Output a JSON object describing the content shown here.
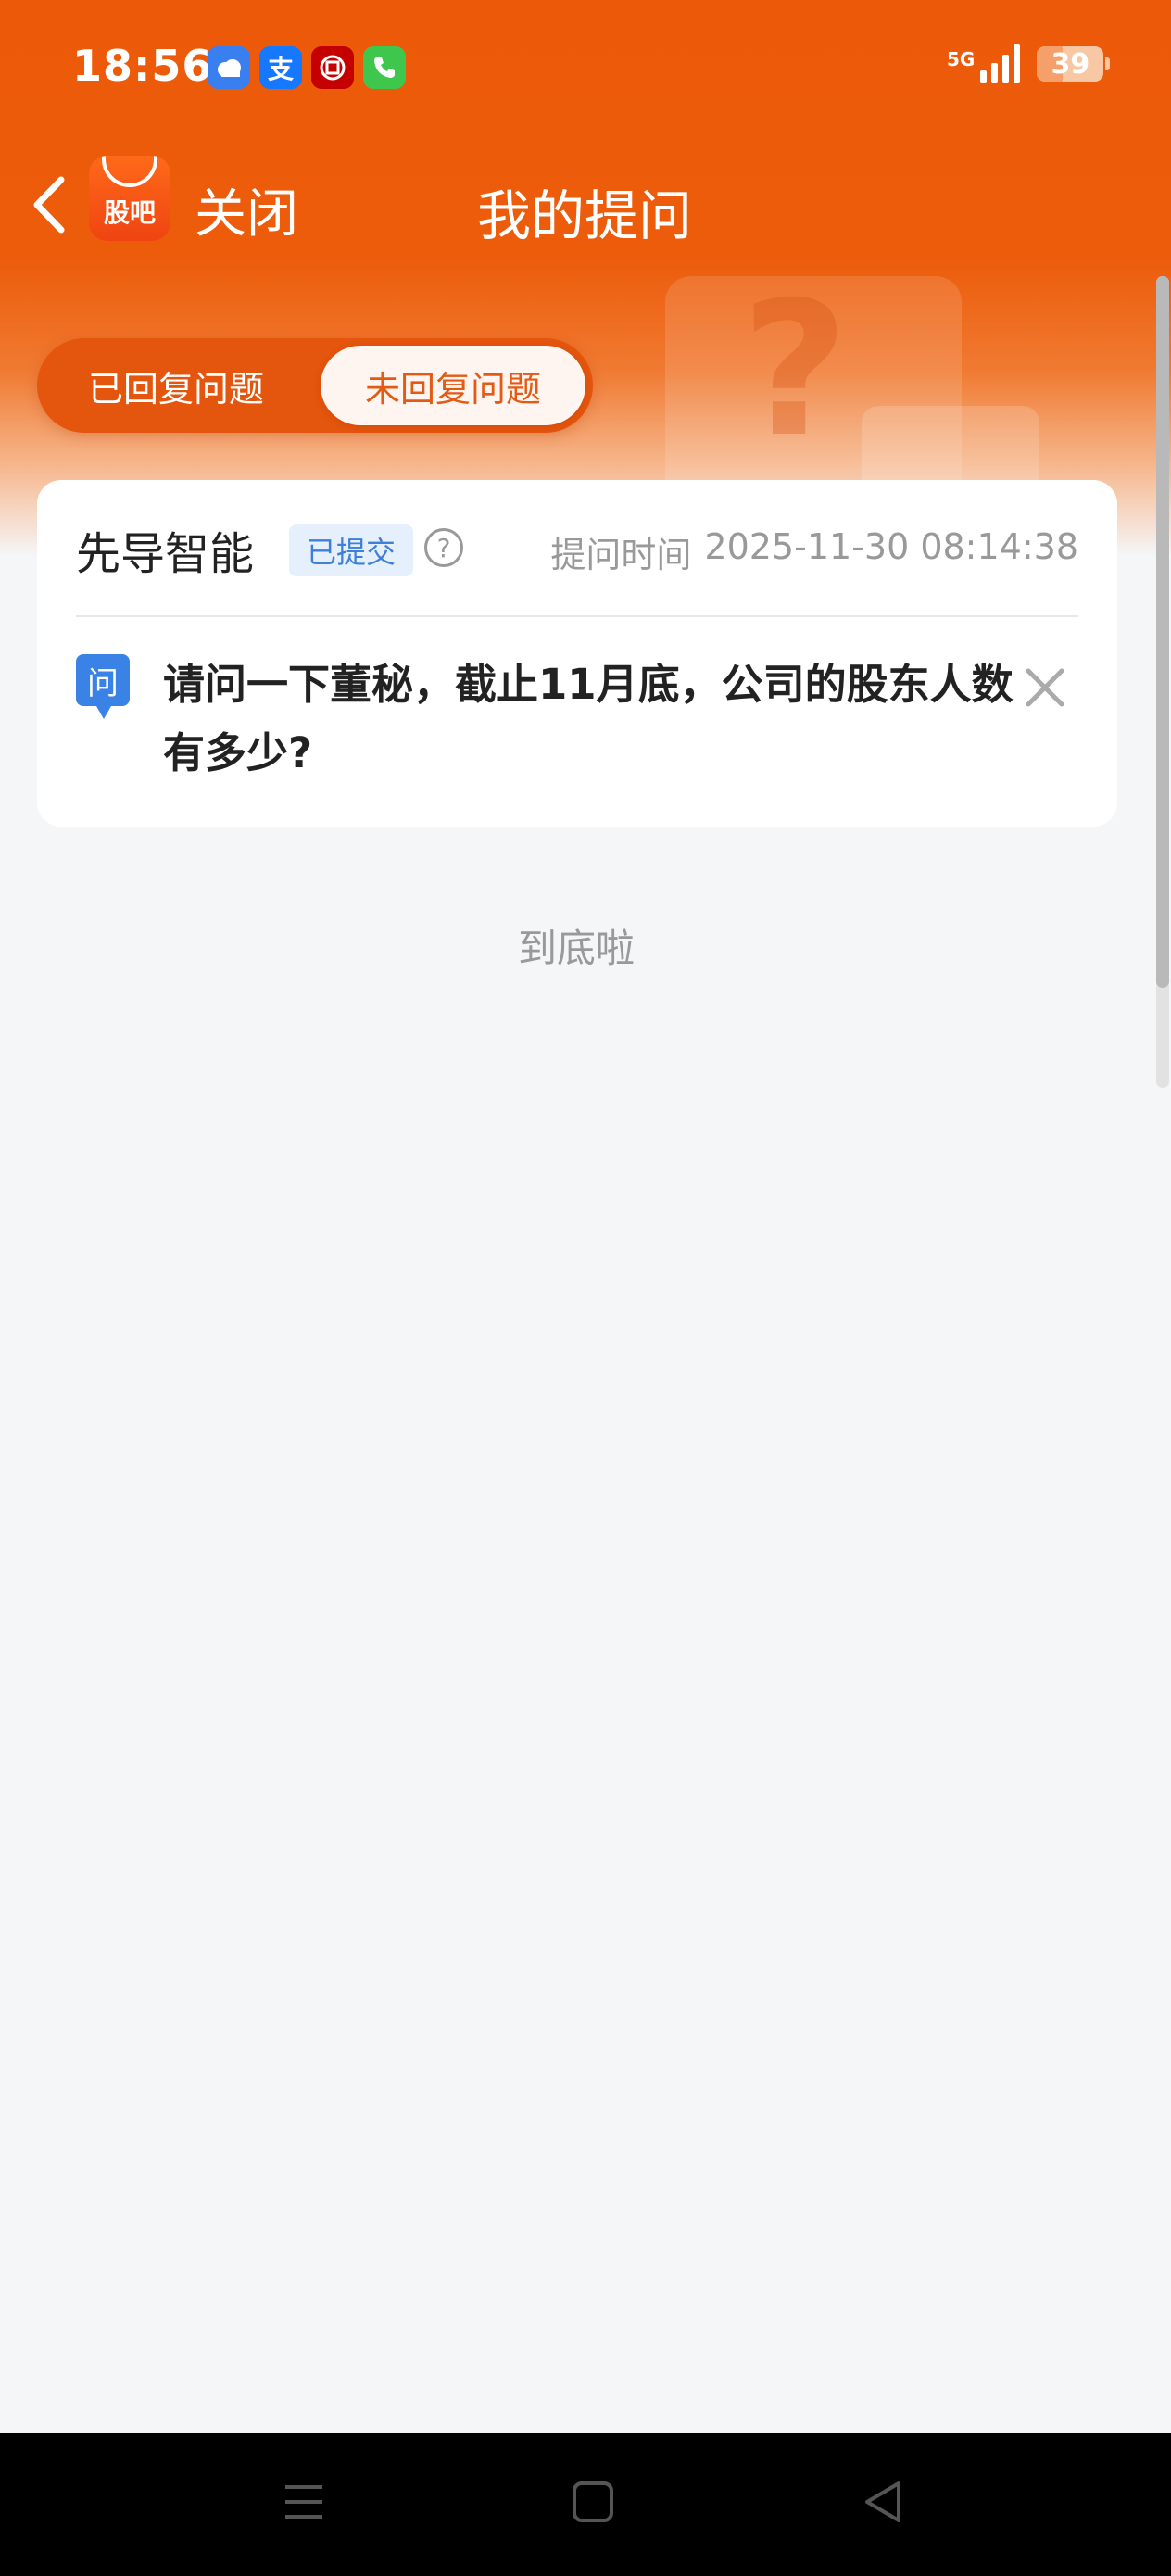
{
  "status_bar": {
    "time": "18:56",
    "network": "5G",
    "battery": "39",
    "battery_level": 0.39,
    "app_icons": [
      "weather-icon",
      "alipay-icon",
      "bank-icon",
      "phone-icon"
    ]
  },
  "header": {
    "close_label": "关闭",
    "title": "我的提问",
    "logo_text": "股吧"
  },
  "tabs": [
    {
      "label": "已回复问题",
      "active": false
    },
    {
      "label": "未回复问题",
      "active": true
    }
  ],
  "question_card": {
    "company": "先导智能",
    "status_badge": "已提交",
    "time_label": "提问时间",
    "time_value": "2025-11-30 08:14:38",
    "question_icon_label": "问",
    "question_text": "请问一下董秘，截止11月底，公司的股东人数有多少?"
  },
  "end_text": "到底啦",
  "colors": {
    "brand": "#ec5a09",
    "badge_blue": "#3d7fd9",
    "question_icon": "#3b82e6"
  }
}
